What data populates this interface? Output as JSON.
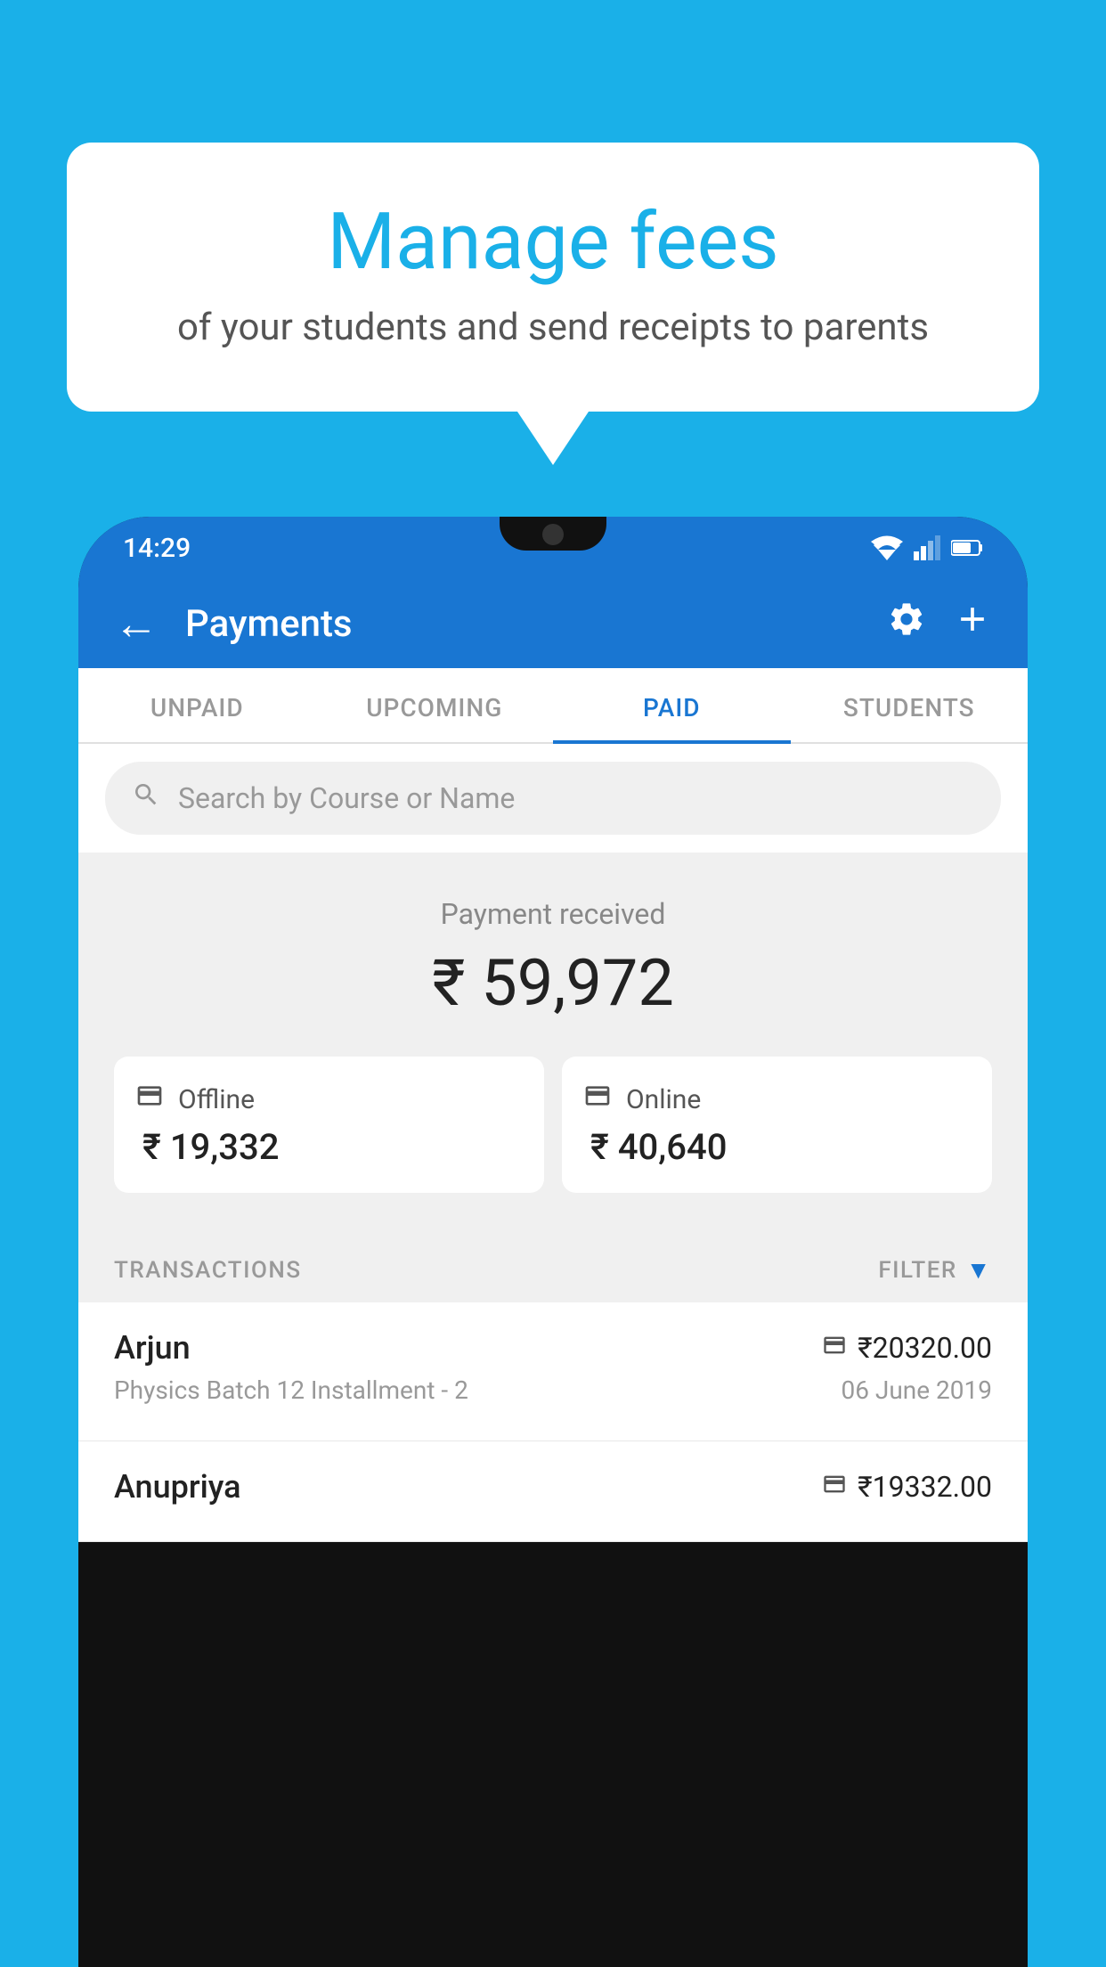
{
  "page": {
    "background_color": "#1ab0e8"
  },
  "speech_bubble": {
    "title": "Manage fees",
    "subtitle": "of your students and send receipts to parents"
  },
  "status_bar": {
    "time": "14:29"
  },
  "app_bar": {
    "title": "Payments",
    "back_label": "←"
  },
  "tabs": [
    {
      "id": "unpaid",
      "label": "UNPAID",
      "active": false
    },
    {
      "id": "upcoming",
      "label": "UPCOMING",
      "active": false
    },
    {
      "id": "paid",
      "label": "PAID",
      "active": true
    },
    {
      "id": "students",
      "label": "STUDENTS",
      "active": false
    }
  ],
  "search": {
    "placeholder": "Search by Course or Name"
  },
  "payment_summary": {
    "label": "Payment received",
    "amount": "₹ 59,972",
    "offline": {
      "type": "Offline",
      "amount": "₹ 19,332"
    },
    "online": {
      "type": "Online",
      "amount": "₹ 40,640"
    }
  },
  "transactions": {
    "label": "TRANSACTIONS",
    "filter_label": "FILTER",
    "items": [
      {
        "name": "Arjun",
        "course": "Physics Batch 12 Installment - 2",
        "amount": "₹20320.00",
        "date": "06 June 2019",
        "payment_type": "online"
      },
      {
        "name": "Anupriya",
        "course": "",
        "amount": "₹19332.00",
        "date": "",
        "payment_type": "offline"
      }
    ]
  }
}
